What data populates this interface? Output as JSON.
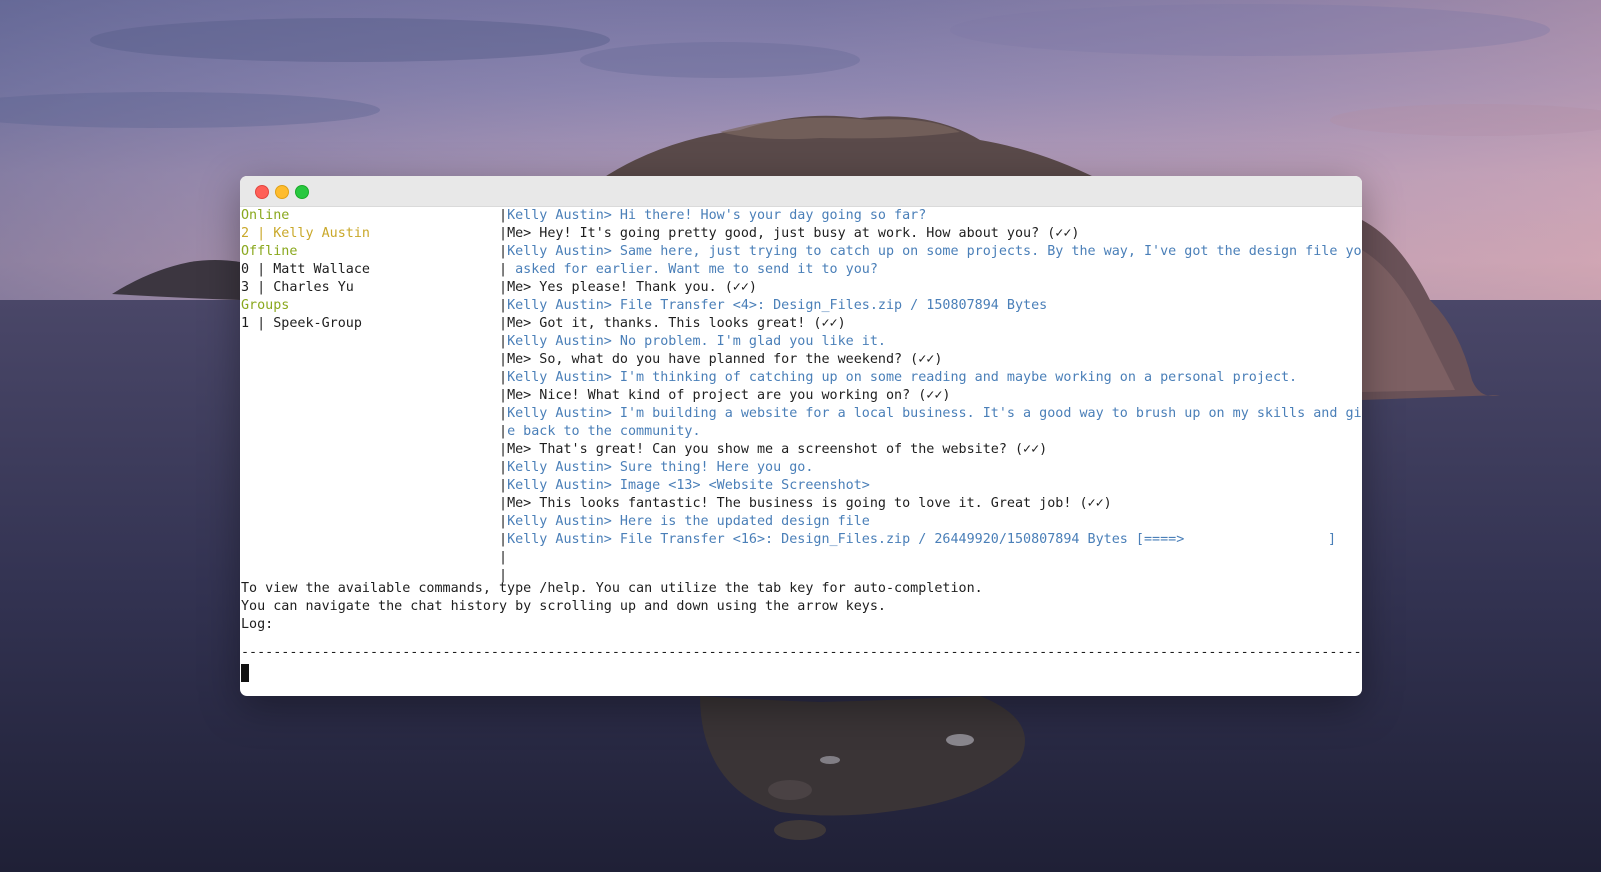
{
  "sidebar": {
    "online_heading": "Online",
    "online": [
      {
        "text": "2 | Kelly Austin"
      }
    ],
    "offline_heading": "Offline",
    "offline": [
      {
        "text": "0 | Matt Wallace"
      },
      {
        "text": "3 | Charles Yu"
      }
    ],
    "groups_heading": "Groups",
    "groups": [
      {
        "text": "1 | Speek-Group"
      }
    ]
  },
  "chat": {
    "separator": "|",
    "messages": [
      {
        "sender": "Kelly Austin",
        "text": "Kelly Austin> Hi there! How's your day going so far?"
      },
      {
        "sender": "Me",
        "text": "Me> Hey! It's going pretty good, just busy at work. How about you? (✓✓)"
      },
      {
        "sender": "Kelly Austin",
        "text": "Kelly Austin> Same here, just trying to catch up on some projects. By the way, I've got the design file you"
      },
      {
        "sender": "Kelly Austin",
        "text": " asked for earlier. Want me to send it to you?"
      },
      {
        "sender": "Me",
        "text": "Me> Yes please! Thank you. (✓✓)"
      },
      {
        "sender": "Kelly Austin",
        "text": "Kelly Austin> File Transfer <4>: Design_Files.zip / 150807894 Bytes"
      },
      {
        "sender": "Me",
        "text": "Me> Got it, thanks. This looks great! (✓✓)"
      },
      {
        "sender": "Kelly Austin",
        "text": "Kelly Austin> No problem. I'm glad you like it."
      },
      {
        "sender": "Me",
        "text": "Me> So, what do you have planned for the weekend? (✓✓)"
      },
      {
        "sender": "Kelly Austin",
        "text": "Kelly Austin> I'm thinking of catching up on some reading and maybe working on a personal project."
      },
      {
        "sender": "Me",
        "text": "Me> Nice! What kind of project are you working on? (✓✓)"
      },
      {
        "sender": "Kelly Austin",
        "text": "Kelly Austin> I'm building a website for a local business. It's a good way to brush up on my skills and giv"
      },
      {
        "sender": "Kelly Austin",
        "text": "e back to the community."
      },
      {
        "sender": "Me",
        "text": "Me> That's great! Can you show me a screenshot of the website? (✓✓)"
      },
      {
        "sender": "Kelly Austin",
        "text": "Kelly Austin> Sure thing! Here you go."
      },
      {
        "sender": "Kelly Austin",
        "text": "Kelly Austin> Image <13> <Website Screenshot>"
      },
      {
        "sender": "Me",
        "text": "Me> This looks fantastic! The business is going to love it. Great job! (✓✓)"
      },
      {
        "sender": "Kelly Austin",
        "text": "Kelly Austin> Here is the updated design file"
      },
      {
        "sender": "Kelly Austin",
        "text": "Kelly Austin> File Transfer <16>: Design_Files.zip / 26449920/150807894 Bytes [====>"
      },
      {
        "sender": "",
        "text": ""
      },
      {
        "sender": "",
        "text": ""
      }
    ],
    "transfer_bar_end": "]",
    "transfer_progress": 0.175
  },
  "footer": {
    "help_line": "To view the available commands, type /help. You can utilize the tab key for auto-completion.",
    "nav_line": "You can navigate the chat history by scrolling up and down using the arrow keys.",
    "log_label": "Log:",
    "divider": "--------------------------------------------------------------------------------------------------------------------------------------------------------------"
  },
  "colors": {
    "online": "#8aa81e",
    "contact_online": "#c9a82a",
    "peer_message": "#4a7fb8",
    "own_message": "#1e1e1e"
  },
  "input": {
    "value": ""
  }
}
